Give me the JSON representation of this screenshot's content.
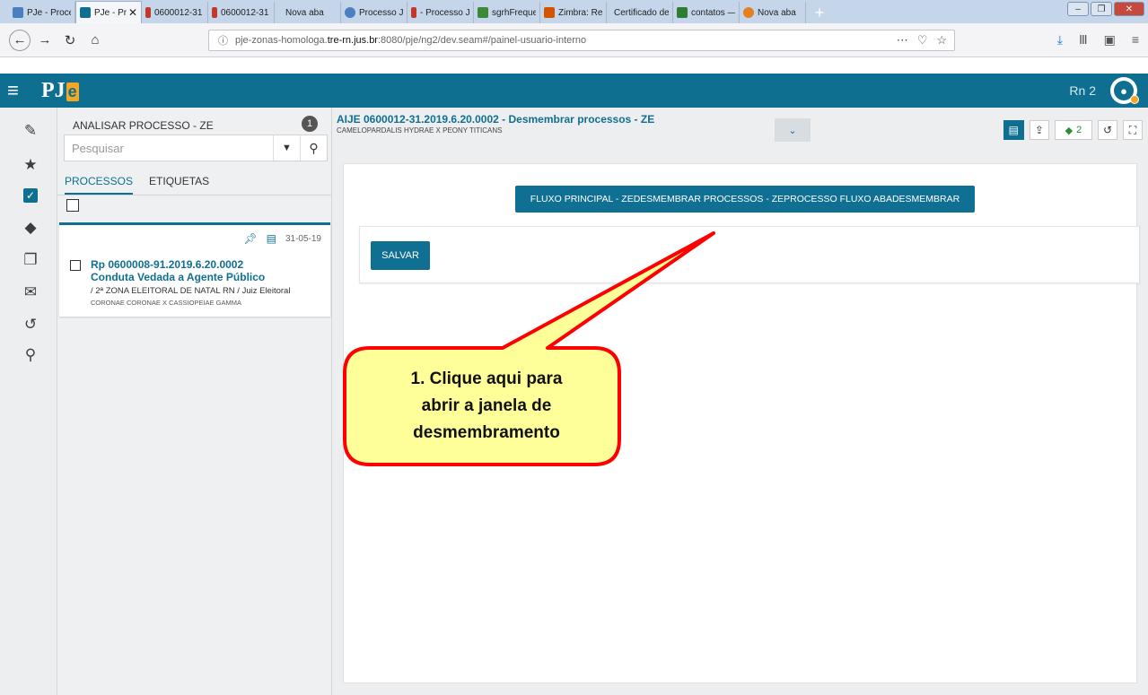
{
  "browser": {
    "tabs": [
      {
        "title": "PJe - Proce",
        "color": "#4a7fc0",
        "active": false
      },
      {
        "title": "PJe - Proces",
        "color": "#0f6f90",
        "active": true
      },
      {
        "title": "0600012-31",
        "color": "#c0392b",
        "active": false
      },
      {
        "title": "0600012-31",
        "color": "#c0392b",
        "active": false
      },
      {
        "title": "Nova aba",
        "color": "",
        "active": false
      },
      {
        "title": "Processo Ju",
        "color": "#4a7fc0",
        "active": false
      },
      {
        "title": "- Processo J",
        "color": "#c0392b",
        "active": false
      },
      {
        "title": "sgrhFreque",
        "color": "#3a8a3a",
        "active": false
      },
      {
        "title": "Zimbra: Res",
        "color": "#d35400",
        "active": false
      },
      {
        "title": "Certificado de P",
        "color": "",
        "active": false
      },
      {
        "title": "contatos —",
        "color": "#2e7d32",
        "active": false
      },
      {
        "title": "Nova aba",
        "color": "#e67e22",
        "active": false
      }
    ],
    "url_prefix": "pje-zonas-homologa.",
    "url_host": "tre-rn.jus.br",
    "url_path": ":8080/pje/ng2/dev.seam#/painel-usuario-interno"
  },
  "header": {
    "logo_text": "PJ",
    "logo_e": "e",
    "user_label": "Rn 2"
  },
  "list": {
    "title": "ANALISAR PROCESSO - ZE",
    "count": "1",
    "search_placeholder": "Pesquisar",
    "tab_processos": "PROCESSOS",
    "tab_etiquetas": "ETIQUETAS",
    "card": {
      "date": "31-05-19",
      "number": "Rp 0600008-91.2019.6.20.0002",
      "class": "Conduta Vedada a Agente Público",
      "orgao": "/ 2ª ZONA ELEITORAL DE NATAL RN / Juiz Eleitoral",
      "partes": "CORONAE CORONAE X CASSIOPEIAE GAMMA"
    }
  },
  "main": {
    "title": "AIJE 0600012-31.2019.6.20.0002 - Desmembrar processos - ZE",
    "subtitle": "CAMELOPARDALIS HYDRAE X PEONY TITICANS",
    "tag_count": "2",
    "flow_button": "FLUXO PRINCIPAL - ZEDESMEMBRAR PROCESSOS - ZEPROCESSO FLUXO ABADESMEMBRAR",
    "save_button": "SALVAR"
  },
  "callout": {
    "line1": "1. Clique aqui para",
    "line2": "abrir a janela de",
    "line3": "desmembramento"
  },
  "colors": {
    "accent": "#0f6f90",
    "callout_fill": "#ffff99",
    "callout_border": "#ff0000"
  }
}
